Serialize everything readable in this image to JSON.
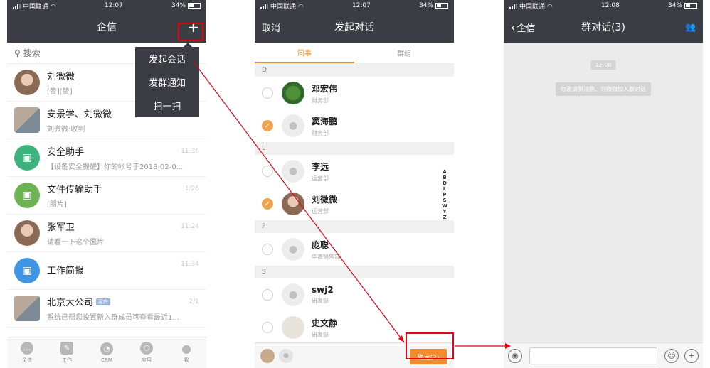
{
  "status_left": {
    "carrier": "中国联通"
  },
  "screens": [
    {
      "status": {
        "time": "12:07",
        "battery": "34%"
      }
    },
    {
      "status": {
        "time": "12:07",
        "battery": "34%"
      }
    },
    {
      "status": {
        "time": "12:08",
        "battery": "34%"
      }
    }
  ],
  "qixin": {
    "title": "企信",
    "add_icon": "+",
    "search_placeholder": "搜索",
    "menu": [
      "发起会话",
      "发群通知",
      "扫一扫"
    ],
    "chats": [
      {
        "name": "刘微微",
        "msg": "[赞][赞]",
        "time": "",
        "icon": "photo-avatar"
      },
      {
        "name": "安景学、刘微微",
        "msg": "刘微微:收到",
        "time": "",
        "icon": "group-avatar"
      },
      {
        "name": "安全助手",
        "msg": "【设备安全提醒】你的帐号于2018-02-0...",
        "time": "11:36",
        "icon": "device-icon",
        "color": "#3fb27e"
      },
      {
        "name": "文件传输助手",
        "msg": "[图片]",
        "time": "1/26",
        "icon": "file-icon",
        "color": "#6db354"
      },
      {
        "name": "张军卫",
        "msg": "请看一下这个图片",
        "time": "11:24",
        "icon": "photo-avatar"
      },
      {
        "name": "工作简报",
        "msg": "",
        "time": "11:34",
        "icon": "report-icon",
        "color": "#3d95e4"
      },
      {
        "name": "北京大公司",
        "badge": "客户",
        "msg": "系统已帮您设置新入群成员可查看最近1...",
        "time": "2/2",
        "icon": "group-avatar"
      }
    ],
    "tabs": [
      "企信",
      "工作",
      "CRM",
      "应用",
      "我"
    ]
  },
  "start_chat": {
    "cancel": "取消",
    "title": "发起对话",
    "seg_tabs": [
      "同事",
      "群组"
    ],
    "sections": [
      {
        "letter": "D",
        "contacts": [
          {
            "name": "邓宏伟",
            "dept": "财务部",
            "checked": false,
            "photo": "tree"
          },
          {
            "name": "窦海鹏",
            "dept": "财务部",
            "checked": true,
            "photo": ""
          }
        ]
      },
      {
        "letter": "L",
        "contacts": [
          {
            "name": "李远",
            "dept": "运营部",
            "checked": false,
            "photo": ""
          },
          {
            "name": "刘微微",
            "dept": "运营部",
            "checked": true,
            "photo": "person"
          }
        ]
      },
      {
        "letter": "P",
        "contacts": [
          {
            "name": "庞聪",
            "dept": "华南销售部",
            "checked": false,
            "photo": ""
          }
        ]
      },
      {
        "letter": "S",
        "contacts": [
          {
            "name": "swj2",
            "dept": "研发部",
            "checked": false,
            "photo": ""
          },
          {
            "name": "史文静",
            "dept": "研发部",
            "checked": false,
            "photo": "light"
          }
        ]
      }
    ],
    "index_letters": [
      "A",
      "B",
      "D",
      "L",
      "P",
      "S",
      "W",
      "Y",
      "Z"
    ],
    "confirm": "确定(2)"
  },
  "group_chat": {
    "back": "企信",
    "title": "群对话(3)",
    "time_chip": "12:08",
    "system_msg": "你邀请窦海鹏、刘微微加入群对话"
  }
}
